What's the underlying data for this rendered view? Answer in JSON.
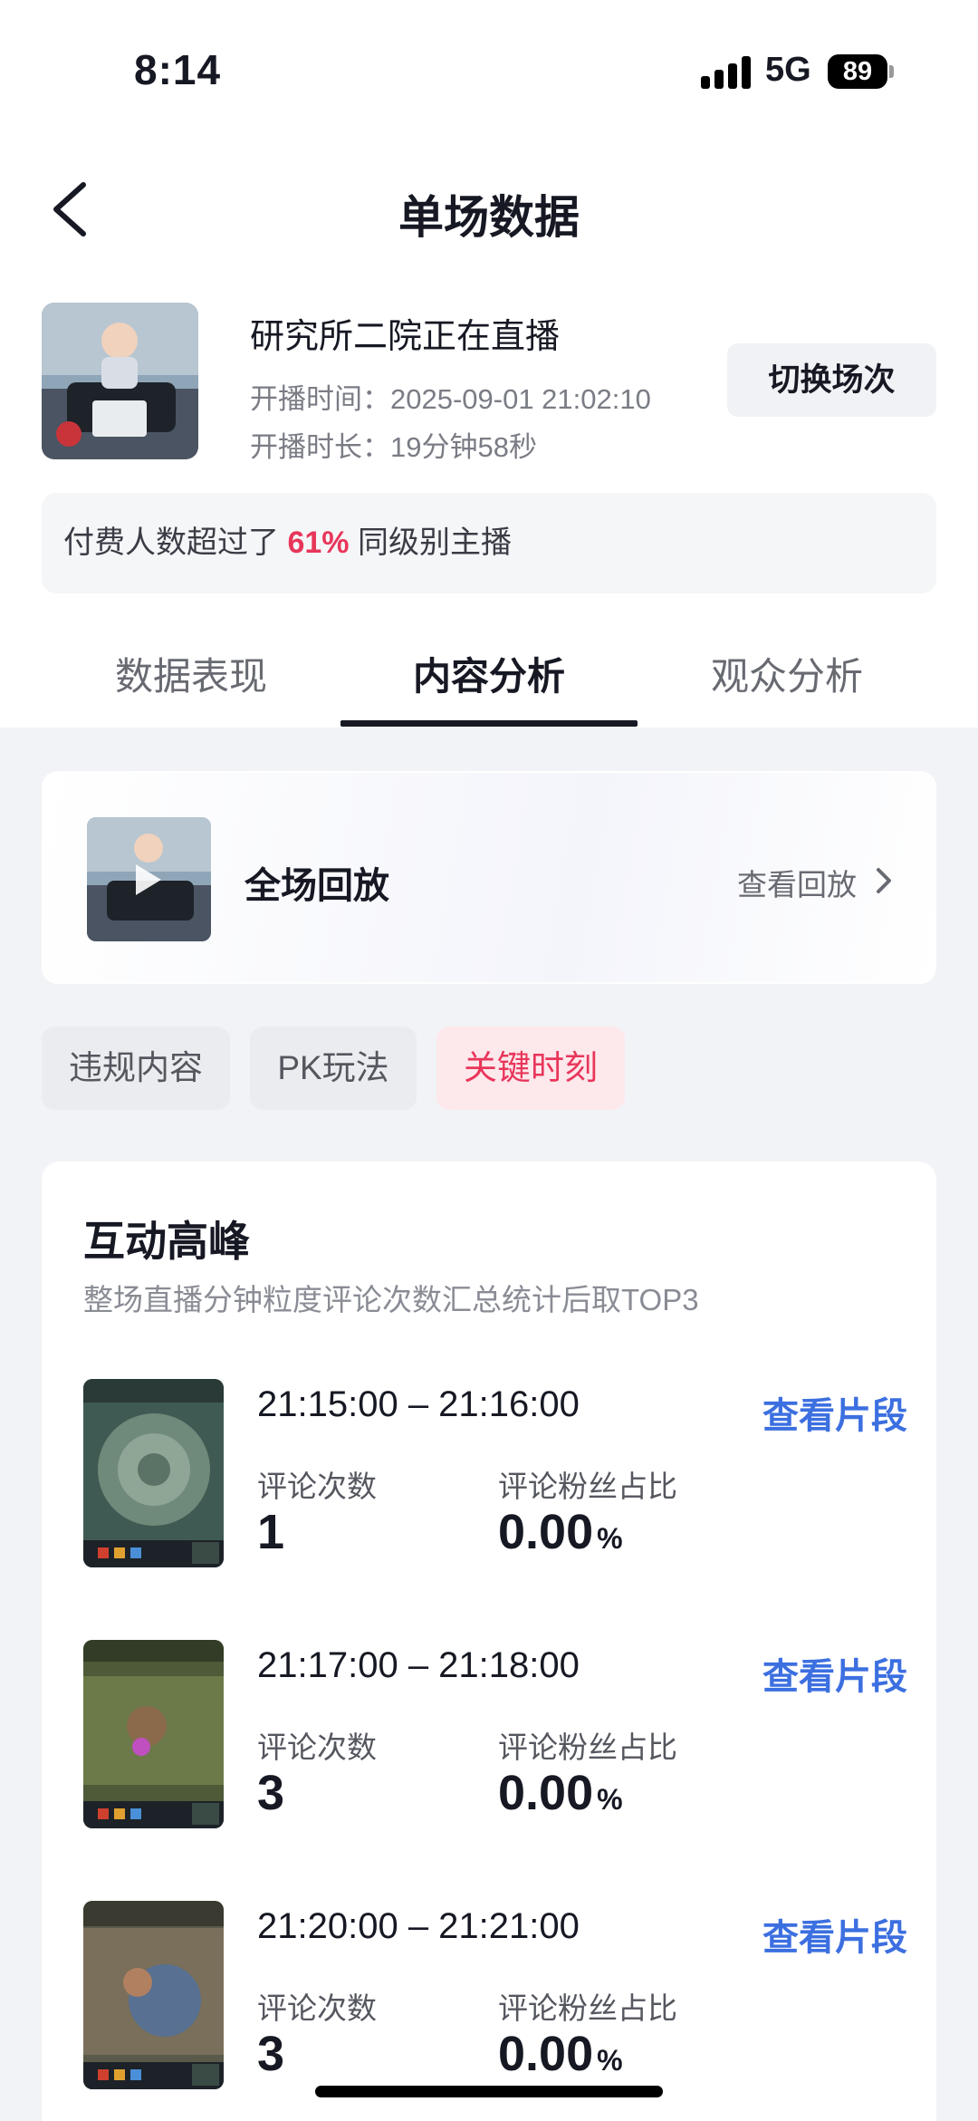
{
  "status_bar": {
    "time": "8:14",
    "network": "5G",
    "battery": "89"
  },
  "nav": {
    "title": "单场数据"
  },
  "anchor": {
    "name": "研究所二院正在直播",
    "start_label": "开播时间：",
    "start_time": "2025-09-01 21:02:10",
    "duration_label": "开播时长：",
    "duration": "19分钟58秒",
    "switch_button": "切换场次"
  },
  "rank": {
    "prefix": "付费人数超过了",
    "percent": "61%",
    "suffix": "同级别主播"
  },
  "tabs": [
    {
      "label": "数据表现",
      "active": false
    },
    {
      "label": "内容分析",
      "active": true
    },
    {
      "label": "观众分析",
      "active": false
    }
  ],
  "replay": {
    "title": "全场回放",
    "link": "查看回放"
  },
  "chips": [
    {
      "label": "违规内容",
      "active": false
    },
    {
      "label": "PK玩法",
      "active": false
    },
    {
      "label": "关键时刻",
      "active": true
    }
  ],
  "peak": {
    "title": "互动高峰",
    "subtitle": "整场直播分钟粒度评论次数汇总统计后取TOP3",
    "comment_count_label": "评论次数",
    "fan_ratio_label": "评论粉丝占比",
    "link_label": "查看片段",
    "unit": "%",
    "rows": [
      {
        "time": "21:15:00 – 21:16:00",
        "comments": "1",
        "fan_ratio": "0.00"
      },
      {
        "time": "21:17:00 – 21:18:00",
        "comments": "3",
        "fan_ratio": "0.00"
      },
      {
        "time": "21:20:00 – 21:21:00",
        "comments": "3",
        "fan_ratio": "0.00"
      }
    ]
  },
  "colors": {
    "accent_pink": "#e8365a",
    "link_blue": "#3c6fe0",
    "text_dark": "#161823"
  }
}
